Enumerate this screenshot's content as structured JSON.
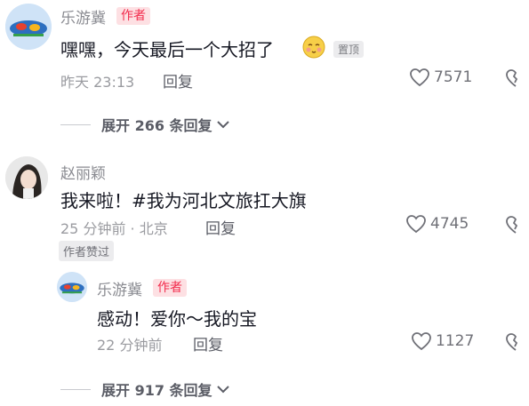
{
  "colors": {
    "author_badge_bg": "#fde0e3",
    "author_badge_text": "#f22c4d",
    "muted": "#8a8b91"
  },
  "comments": [
    {
      "user": "乐游冀",
      "author_badge": "作者",
      "text": "嘿嘿，今天最后一个大招了",
      "emoji": "shy-face-emoji",
      "pinned": "置顶",
      "time": "昨天 23:13",
      "reply": "回复",
      "likes": "7571",
      "expand": "展开 266 条回复"
    },
    {
      "user": "赵丽颖",
      "text": "我来啦！#我为河北文旅扛大旗",
      "time": "25 分钟前 · 北京",
      "reply": "回复",
      "likes": "4745",
      "liked_by_author": "作者赞过"
    },
    {
      "user": "乐游冀",
      "author_badge": "作者",
      "text": "感动！爱你～我的宝",
      "time": "22 分钟前",
      "reply": "回复",
      "likes": "1127",
      "expand": "展开 917 条回复"
    }
  ]
}
